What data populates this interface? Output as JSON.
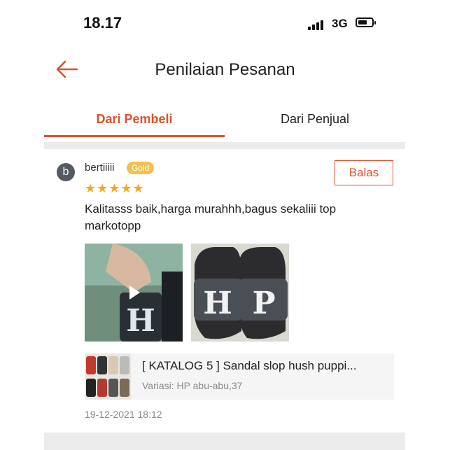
{
  "status": {
    "time": "18.17",
    "network": "3G"
  },
  "header": {
    "title": "Penilaian Pesanan"
  },
  "tabs": [
    {
      "label": "Dari Pembeli"
    },
    {
      "label": "Dari Penjual"
    }
  ],
  "review": {
    "avatar_letter": "b",
    "username": "bertiiiii",
    "badge": "Gold",
    "reply_label": "Balas",
    "rating": 5,
    "stars": "★★★★★",
    "comment": "Kalitasss baik,harga murahhh,bagus sekaliii top markotopp",
    "photos": [
      {
        "type": "video",
        "letters": "H"
      },
      {
        "type": "image",
        "letters": "HP"
      }
    ],
    "product": {
      "name": "[ KATALOG 5 ] Sandal slop hush puppi...",
      "variant": "Variasi: HP abu-abu,37"
    },
    "date": "19-12-2021 18:12"
  },
  "colors": {
    "accent": "#d9532c",
    "badge": "#f2c14c",
    "star": "#f6a623"
  }
}
